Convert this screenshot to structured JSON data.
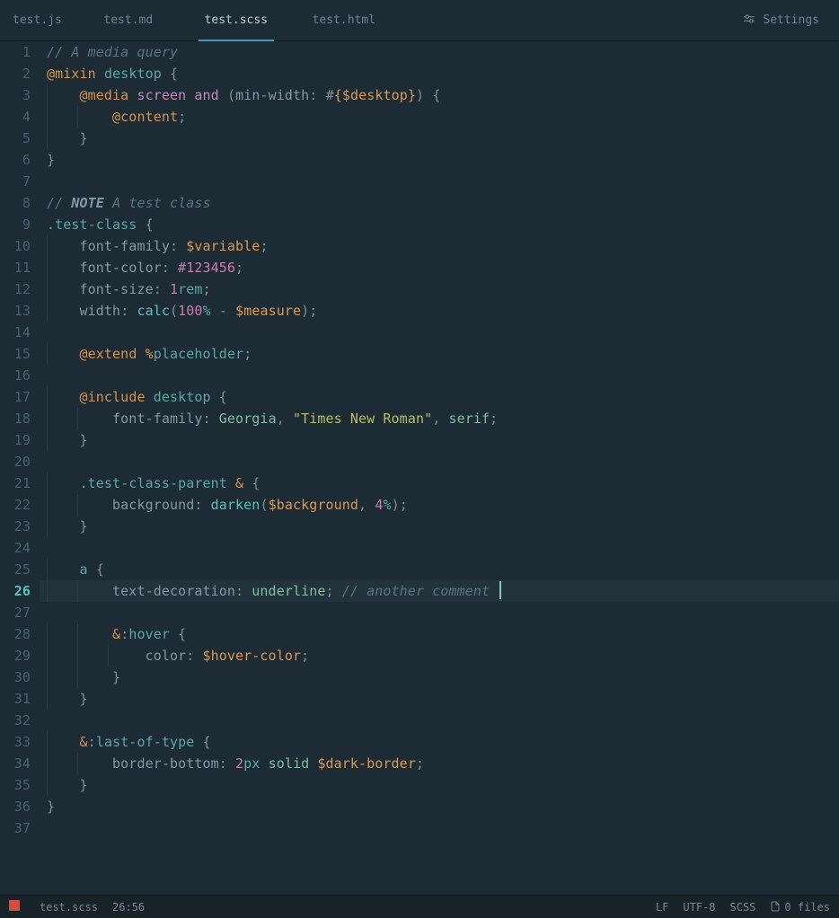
{
  "tabs": {
    "items": [
      {
        "label": "test.js",
        "active": false
      },
      {
        "label": "test.md",
        "active": false
      },
      {
        "label": "test.scss",
        "active": true
      },
      {
        "label": "test.html",
        "active": false
      }
    ],
    "settings_label": "Settings"
  },
  "gutter": {
    "line_count": 37,
    "current_line": 26
  },
  "cursor": {
    "line": 26,
    "col": 56
  },
  "code": {
    "lines": [
      {
        "n": 1,
        "indent": 0,
        "tokens": [
          [
            "c-comment",
            "// A media query"
          ]
        ]
      },
      {
        "n": 2,
        "indent": 0,
        "tokens": [
          [
            "c-dir",
            "@mixin"
          ],
          [
            "",
            " "
          ],
          [
            "c-name",
            "desktop"
          ],
          [
            "",
            " "
          ],
          [
            "c-brace",
            "{"
          ]
        ]
      },
      {
        "n": 3,
        "indent": 1,
        "tokens": [
          [
            "c-dir",
            "@media"
          ],
          [
            "",
            " "
          ],
          [
            "c-kw",
            "screen"
          ],
          [
            "",
            " "
          ],
          [
            "c-kw",
            "and"
          ],
          [
            "",
            " "
          ],
          [
            "c-brace",
            "("
          ],
          [
            "c-prop",
            "min-width"
          ],
          [
            "c-punct",
            ":"
          ],
          [
            "",
            " "
          ],
          [
            "c-punct",
            "#"
          ],
          [
            "c-bracepair",
            "{"
          ],
          [
            "c-var",
            "$desktop"
          ],
          [
            "c-bracepair",
            "}"
          ],
          [
            "c-brace",
            ")"
          ],
          [
            "",
            " "
          ],
          [
            "c-brace",
            "{"
          ]
        ]
      },
      {
        "n": 4,
        "indent": 2,
        "tokens": [
          [
            "c-dir",
            "@content"
          ],
          [
            "c-punct",
            ";"
          ]
        ]
      },
      {
        "n": 5,
        "indent": 1,
        "tokens": [
          [
            "c-brace",
            "}"
          ]
        ]
      },
      {
        "n": 6,
        "indent": 0,
        "tokens": [
          [
            "c-brace",
            "}"
          ]
        ]
      },
      {
        "n": 7,
        "indent": 0,
        "tokens": []
      },
      {
        "n": 8,
        "indent": 0,
        "tokens": [
          [
            "c-comment",
            "// "
          ],
          [
            "c-note",
            "NOTE"
          ],
          [
            "c-comment",
            " A test class"
          ]
        ]
      },
      {
        "n": 9,
        "indent": 0,
        "tokens": [
          [
            "c-sel",
            ".test-class"
          ],
          [
            "",
            " "
          ],
          [
            "c-brace",
            "{"
          ]
        ]
      },
      {
        "n": 10,
        "indent": 1,
        "tokens": [
          [
            "c-prop",
            "font-family"
          ],
          [
            "c-punct",
            ":"
          ],
          [
            "",
            " "
          ],
          [
            "c-var",
            "$variable"
          ],
          [
            "c-punct",
            ";"
          ]
        ]
      },
      {
        "n": 11,
        "indent": 1,
        "tokens": [
          [
            "c-prop",
            "font-color"
          ],
          [
            "c-punct",
            ":"
          ],
          [
            "",
            " "
          ],
          [
            "c-num",
            "#123456"
          ],
          [
            "c-punct",
            ";"
          ]
        ]
      },
      {
        "n": 12,
        "indent": 1,
        "tokens": [
          [
            "c-prop",
            "font-size"
          ],
          [
            "c-punct",
            ":"
          ],
          [
            "",
            " "
          ],
          [
            "c-num",
            "1"
          ],
          [
            "c-unit",
            "rem"
          ],
          [
            "c-punct",
            ";"
          ]
        ]
      },
      {
        "n": 13,
        "indent": 1,
        "tokens": [
          [
            "c-prop",
            "width"
          ],
          [
            "c-punct",
            ":"
          ],
          [
            "",
            " "
          ],
          [
            "c-func",
            "calc"
          ],
          [
            "c-brace",
            "("
          ],
          [
            "c-num",
            "100"
          ],
          [
            "c-unit",
            "%"
          ],
          [
            "",
            " "
          ],
          [
            "c-op",
            "-"
          ],
          [
            "",
            " "
          ],
          [
            "c-var",
            "$measure"
          ],
          [
            "c-brace",
            ")"
          ],
          [
            "c-punct",
            ";"
          ]
        ]
      },
      {
        "n": 14,
        "indent": 0,
        "tokens": []
      },
      {
        "n": 15,
        "indent": 1,
        "tokens": [
          [
            "c-dir",
            "@extend"
          ],
          [
            "",
            " "
          ],
          [
            "c-pct",
            "%"
          ],
          [
            "c-name",
            "placeholder"
          ],
          [
            "c-punct",
            ";"
          ]
        ]
      },
      {
        "n": 16,
        "indent": 0,
        "tokens": []
      },
      {
        "n": 17,
        "indent": 1,
        "tokens": [
          [
            "c-dir",
            "@include"
          ],
          [
            "",
            " "
          ],
          [
            "c-name",
            "desktop"
          ],
          [
            "",
            " "
          ],
          [
            "c-brace",
            "{"
          ]
        ]
      },
      {
        "n": 18,
        "indent": 2,
        "tokens": [
          [
            "c-prop",
            "font-family"
          ],
          [
            "c-punct",
            ":"
          ],
          [
            "",
            " "
          ],
          [
            "c-val",
            "Georgia"
          ],
          [
            "c-punct",
            ","
          ],
          [
            "",
            " "
          ],
          [
            "c-str",
            "\"Times New Roman\""
          ],
          [
            "c-punct",
            ","
          ],
          [
            "",
            " "
          ],
          [
            "c-val",
            "serif"
          ],
          [
            "c-punct",
            ";"
          ]
        ]
      },
      {
        "n": 19,
        "indent": 1,
        "tokens": [
          [
            "c-brace",
            "}"
          ]
        ]
      },
      {
        "n": 20,
        "indent": 0,
        "tokens": []
      },
      {
        "n": 21,
        "indent": 1,
        "tokens": [
          [
            "c-sel",
            ".test-class-parent"
          ],
          [
            "",
            " "
          ],
          [
            "c-amp",
            "&"
          ],
          [
            "",
            " "
          ],
          [
            "c-brace",
            "{"
          ]
        ]
      },
      {
        "n": 22,
        "indent": 2,
        "tokens": [
          [
            "c-prop",
            "background"
          ],
          [
            "c-punct",
            ":"
          ],
          [
            "",
            " "
          ],
          [
            "c-func",
            "darken"
          ],
          [
            "c-brace",
            "("
          ],
          [
            "c-var",
            "$background"
          ],
          [
            "c-punct",
            ","
          ],
          [
            "",
            " "
          ],
          [
            "c-num",
            "4"
          ],
          [
            "c-unit",
            "%"
          ],
          [
            "c-brace",
            ")"
          ],
          [
            "c-punct",
            ";"
          ]
        ]
      },
      {
        "n": 23,
        "indent": 1,
        "tokens": [
          [
            "c-brace",
            "}"
          ]
        ]
      },
      {
        "n": 24,
        "indent": 0,
        "tokens": []
      },
      {
        "n": 25,
        "indent": 1,
        "tokens": [
          [
            "c-sel",
            "a"
          ],
          [
            "",
            " "
          ],
          [
            "c-brace",
            "{"
          ]
        ]
      },
      {
        "n": 26,
        "indent": 2,
        "tokens": [
          [
            "c-prop",
            "text-decoration"
          ],
          [
            "c-punct",
            ":"
          ],
          [
            "",
            " "
          ],
          [
            "c-val",
            "underline"
          ],
          [
            "c-punct",
            ";"
          ],
          [
            "",
            " "
          ],
          [
            "c-comment",
            "// another comment"
          ]
        ],
        "cursor_after": true
      },
      {
        "n": 27,
        "indent": 0,
        "tokens": []
      },
      {
        "n": 28,
        "indent": 2,
        "tokens": [
          [
            "c-amp",
            "&"
          ],
          [
            "c-punct",
            ":"
          ],
          [
            "c-sel",
            "hover"
          ],
          [
            "",
            " "
          ],
          [
            "c-brace",
            "{"
          ]
        ]
      },
      {
        "n": 29,
        "indent": 3,
        "tokens": [
          [
            "c-prop",
            "color"
          ],
          [
            "c-punct",
            ":"
          ],
          [
            "",
            " "
          ],
          [
            "c-var",
            "$hover-color"
          ],
          [
            "c-punct",
            ";"
          ]
        ]
      },
      {
        "n": 30,
        "indent": 2,
        "tokens": [
          [
            "c-brace",
            "}"
          ]
        ]
      },
      {
        "n": 31,
        "indent": 1,
        "tokens": [
          [
            "c-brace",
            "}"
          ]
        ]
      },
      {
        "n": 32,
        "indent": 0,
        "tokens": []
      },
      {
        "n": 33,
        "indent": 1,
        "tokens": [
          [
            "c-amp",
            "&"
          ],
          [
            "c-punct",
            ":"
          ],
          [
            "c-sel",
            "last-of-type"
          ],
          [
            "",
            " "
          ],
          [
            "c-brace",
            "{"
          ]
        ]
      },
      {
        "n": 34,
        "indent": 2,
        "tokens": [
          [
            "c-prop",
            "border-bottom"
          ],
          [
            "c-punct",
            ":"
          ],
          [
            "",
            " "
          ],
          [
            "c-num",
            "2"
          ],
          [
            "c-unit",
            "px"
          ],
          [
            "",
            " "
          ],
          [
            "c-val",
            "solid"
          ],
          [
            "",
            " "
          ],
          [
            "c-var",
            "$dark-border"
          ],
          [
            "c-punct",
            ";"
          ]
        ]
      },
      {
        "n": 35,
        "indent": 1,
        "tokens": [
          [
            "c-brace",
            "}"
          ]
        ]
      },
      {
        "n": 36,
        "indent": 0,
        "tokens": [
          [
            "c-brace",
            "}"
          ]
        ]
      },
      {
        "n": 37,
        "indent": 0,
        "tokens": []
      }
    ]
  },
  "status": {
    "filename": "test.scss",
    "cursor": "26:56",
    "eol": "LF",
    "encoding": "UTF-8",
    "lang": "SCSS",
    "files": "0 files"
  },
  "colors": {
    "accent": "#4c99b6",
    "bg": "#1d2b34"
  }
}
